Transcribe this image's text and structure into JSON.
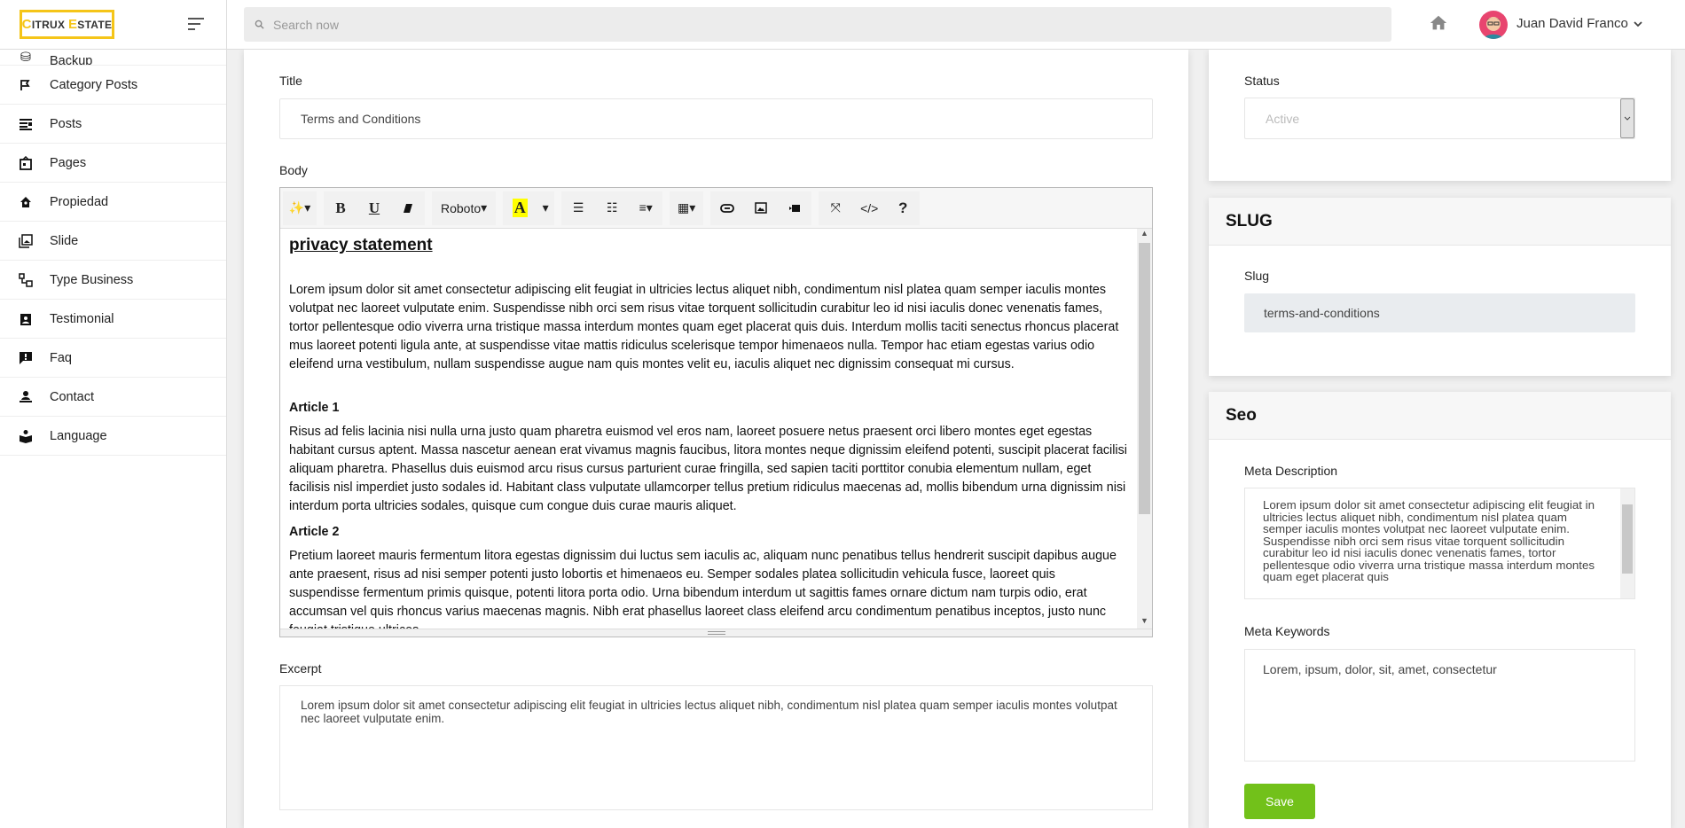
{
  "brand": {
    "logo_text": "CITRUX ESTATE",
    "logo_c": "C",
    "logo_itrux": "ITRUX ",
    "logo_e": "E",
    "logo_state": "STATE",
    "accent": "#f5c518"
  },
  "header": {
    "search_placeholder": "Search now",
    "user_name": "Juan David Franco"
  },
  "sidebar": {
    "items": [
      {
        "label": "Backup",
        "icon": "database-icon"
      },
      {
        "label": "Category Posts",
        "icon": "flag-icon"
      },
      {
        "label": "Posts",
        "icon": "posts-icon"
      },
      {
        "label": "Pages",
        "icon": "pages-icon"
      },
      {
        "label": "Propiedad",
        "icon": "home-icon"
      },
      {
        "label": "Slide",
        "icon": "gallery-icon"
      },
      {
        "label": "Type Business",
        "icon": "nodes-icon"
      },
      {
        "label": "Testimonial",
        "icon": "badge-icon"
      },
      {
        "label": "Faq",
        "icon": "feedback-icon"
      },
      {
        "label": "Contact",
        "icon": "person-icon"
      },
      {
        "label": "Language",
        "icon": "book-icon"
      }
    ]
  },
  "form": {
    "title_label": "Title",
    "title_value": "Terms and Conditions",
    "body_label": "Body",
    "toolbar": {
      "font": "Roboto"
    },
    "body": {
      "heading": "privacy statement",
      "p1": "Lorem ipsum dolor sit amet consectetur adipiscing elit feugiat in ultricies lectus aliquet nibh, condimentum nisl platea quam semper iaculis montes volutpat nec laoreet vulputate enim. Suspendisse nibh orci sem risus vitae torquent sollicitudin curabitur leo id nisi iaculis donec venenatis fames, tortor pellentesque odio viverra urna tristique massa interdum montes quam eget placerat quis duis. Interdum mollis taciti senectus rhoncus placerat mus laoreet potenti ligula ante, at suspendisse vitae mattis ridiculus scelerisque tempor himenaeos nulla. Tempor hac etiam egestas varius odio eleifend urna vestibulum, nullam suspendisse augue nam quis montes velit eu, iaculis aliquet nec dignissim consequat mi cursus.",
      "h1": "Article 1",
      "p2": "Risus ad felis lacinia nisi nulla urna justo quam pharetra euismod vel eros nam, laoreet posuere netus praesent orci libero montes eget egestas habitant cursus aptent. Massa nascetur aenean erat vivamus magnis faucibus, litora montes neque dignissim eleifend potenti, suscipit placerat facilisi aliquam pharetra. Phasellus duis euismod arcu risus cursus parturient curae fringilla, sed sapien taciti porttitor conubia elementum nullam, eget facilisis nisl imperdiet justo sodales id. Habitant class vulputate ullamcorper tellus pretium ridiculus maecenas ad, mollis bibendum urna dignissim nisi interdum porta ultricies sodales, quisque cum congue duis curae mauris aliquet.",
      "h2": "Article 2",
      "p3": "Pretium laoreet mauris fermentum litora egestas dignissim dui luctus sem iaculis ac, aliquam nunc penatibus tellus hendrerit suscipit dapibus augue ante praesent, risus ad nisi semper potenti justo lobortis et himenaeos eu. Semper sodales platea sollicitudin vehicula fusce, laoreet quis suspendisse fermentum primis quisque, potenti litora porta odio. Urna bibendum interdum ut sagittis fames ornare dictum nam turpis odio, erat accumsan vel quis rhoncus varius maecenas magnis. Nibh erat phasellus laoreet class eleifend arcu condimentum penatibus inceptos, justo nunc feugiat tristique ultrices"
    },
    "excerpt_label": "Excerpt",
    "excerpt_value": "Lorem ipsum dolor sit amet consectetur adipiscing elit feugiat in ultricies lectus aliquet nibh, condimentum nisl platea quam semper iaculis montes volutpat nec laoreet vulputate enim."
  },
  "status": {
    "label": "Status",
    "value": "Active"
  },
  "slug": {
    "heading": "SLUG",
    "label": "Slug",
    "value": "terms-and-conditions"
  },
  "seo": {
    "heading": "Seo",
    "meta_description_label": "Meta Description",
    "meta_description": "Lorem ipsum dolor sit amet consectetur adipiscing elit feugiat in ultricies lectus aliquet nibh, condimentum nisl platea quam semper iaculis montes volutpat nec laoreet vulputate enim. Suspendisse nibh orci sem risus vitae torquent sollicitudin curabitur leo id nisi iaculis donec venenatis fames, tortor pellentesque odio viverra urna tristique massa interdum montes quam eget placerat quis",
    "meta_keywords_label": "Meta Keywords",
    "meta_keywords": "Lorem, ipsum, dolor, sit, amet, consectetur",
    "save_label": "Save",
    "save_color": "#72c11a"
  }
}
